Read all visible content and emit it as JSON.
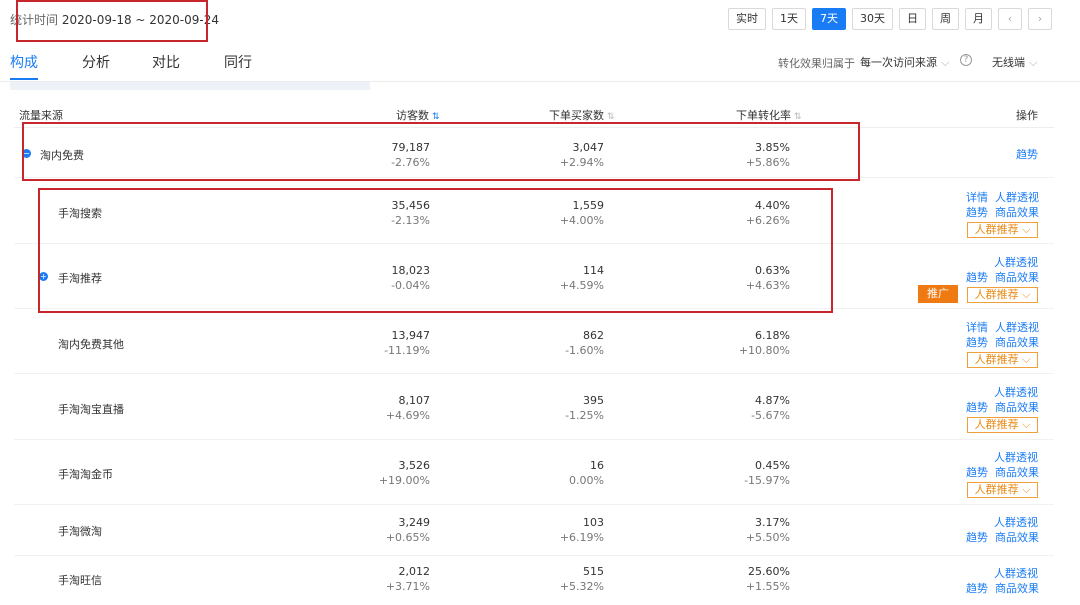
{
  "header": {
    "date_label": "统计时间",
    "date_range": "2020-09-18 ~ 2020-09-24",
    "range_buttons": [
      "实时",
      "1天",
      "7天",
      "30天",
      "日",
      "周",
      "月"
    ],
    "active_range": "7天",
    "prev_icon": "‹",
    "next_icon": "›"
  },
  "tabs": [
    "构成",
    "分析",
    "对比",
    "同行"
  ],
  "active_tab": "构成",
  "attribution": {
    "label": "转化效果归属于",
    "value": "每一次访问来源",
    "help": "?",
    "device": "无线端"
  },
  "table": {
    "columns": [
      "流量来源",
      "访客数",
      "下单买家数",
      "下单转化率",
      "操作"
    ],
    "rows": [
      {
        "name": "淘内免费",
        "visitors": "79,187",
        "visitors_delta": "-2.76%",
        "buyers": "3,047",
        "buyers_delta": "+2.94%",
        "rate": "3.85%",
        "rate_delta": "+5.86%",
        "links": [
          "趋势"
        ]
      },
      {
        "name": "手淘搜索",
        "visitors": "35,456",
        "visitors_delta": "-2.13%",
        "buyers": "1,559",
        "buyers_delta": "+4.00%",
        "rate": "4.40%",
        "rate_delta": "+6.26%",
        "links": [
          "详情",
          "人群透视",
          "趋势",
          "商品效果"
        ],
        "crowd": "人群推荐"
      },
      {
        "name": "手淘推荐",
        "visitors": "18,023",
        "visitors_delta": "-0.04%",
        "buyers": "114",
        "buyers_delta": "+4.59%",
        "rate": "0.63%",
        "rate_delta": "+4.63%",
        "links": [
          "人群透视",
          "趋势",
          "商品效果"
        ],
        "crowd": "人群推荐",
        "promo": "推广"
      },
      {
        "name": "淘内免费其他",
        "visitors": "13,947",
        "visitors_delta": "-11.19%",
        "buyers": "862",
        "buyers_delta": "-1.60%",
        "rate": "6.18%",
        "rate_delta": "+10.80%",
        "links": [
          "详情",
          "人群透视",
          "趋势",
          "商品效果"
        ],
        "crowd": "人群推荐"
      },
      {
        "name": "手淘淘宝直播",
        "visitors": "8,107",
        "visitors_delta": "+4.69%",
        "buyers": "395",
        "buyers_delta": "-1.25%",
        "rate": "4.87%",
        "rate_delta": "-5.67%",
        "links": [
          "人群透视",
          "趋势",
          "商品效果"
        ],
        "crowd": "人群推荐"
      },
      {
        "name": "手淘淘金币",
        "visitors": "3,526",
        "visitors_delta": "+19.00%",
        "buyers": "16",
        "buyers_delta": "0.00%",
        "rate": "0.45%",
        "rate_delta": "-15.97%",
        "links": [
          "人群透视",
          "趋势",
          "商品效果"
        ],
        "crowd": "人群推荐"
      },
      {
        "name": "手淘微淘",
        "visitors": "3,249",
        "visitors_delta": "+0.65%",
        "buyers": "103",
        "buyers_delta": "+6.19%",
        "rate": "3.17%",
        "rate_delta": "+5.50%",
        "links": [
          "人群透视",
          "趋势",
          "商品效果"
        ]
      },
      {
        "name": "手淘旺信",
        "visitors": "2,012",
        "visitors_delta": "+3.71%",
        "buyers": "515",
        "buyers_delta": "+5.32%",
        "rate": "25.60%",
        "rate_delta": "+1.55%",
        "links": [
          "人群透视",
          "趋势",
          "商品效果"
        ]
      }
    ]
  }
}
